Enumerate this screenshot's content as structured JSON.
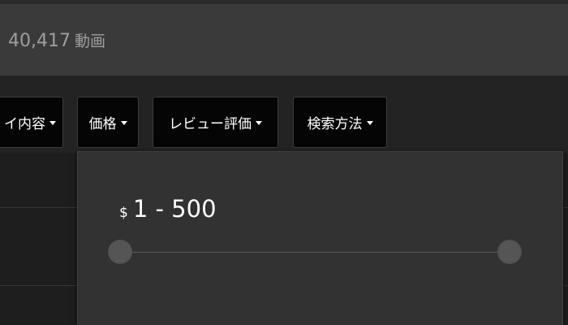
{
  "results": {
    "count": "40,417",
    "unit": "動画"
  },
  "filters": [
    {
      "label": "イ内容"
    },
    {
      "label": "価格"
    },
    {
      "label": "レビュー評価"
    },
    {
      "label": "検索方法"
    }
  ],
  "price_filter": {
    "currency": "$",
    "range": "1 - 500",
    "min_value": 1,
    "max_value": 500,
    "slider_min": 1,
    "slider_max": 500
  },
  "colors": {
    "background": "#1f1f1f",
    "count_bar": "#3a3a3a",
    "button_bg": "#050505",
    "panel_bg": "#323232",
    "handle": "#555555"
  }
}
